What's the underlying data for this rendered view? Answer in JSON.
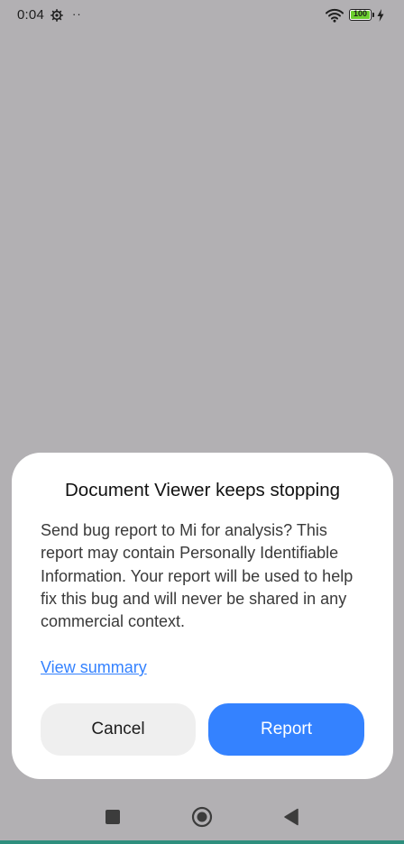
{
  "status_bar": {
    "time": "0:04",
    "dots": "··",
    "battery_level": "100",
    "icons": [
      "settings-gear-icon",
      "wifi-icon",
      "battery-icon",
      "charging-bolt-icon"
    ]
  },
  "dialog": {
    "title": "Document Viewer keeps stopping",
    "message": "Send bug report to Mi for analysis? This report may contain Personally Identifiable Information. Your report will be used to help fix this bug and will never be shared in any commercial context.",
    "link_label": "View summary",
    "cancel_label": "Cancel",
    "report_label": "Report"
  },
  "nav_bar": {
    "icons": [
      "recents-square-icon",
      "home-circle-icon",
      "back-triangle-icon"
    ]
  },
  "colors": {
    "scrim": "#b2b0b3",
    "dialog_bg": "#ffffff",
    "accent": "#3482ff",
    "cancel_bg": "#efefef",
    "battery_fill": "#6ccf2f"
  }
}
